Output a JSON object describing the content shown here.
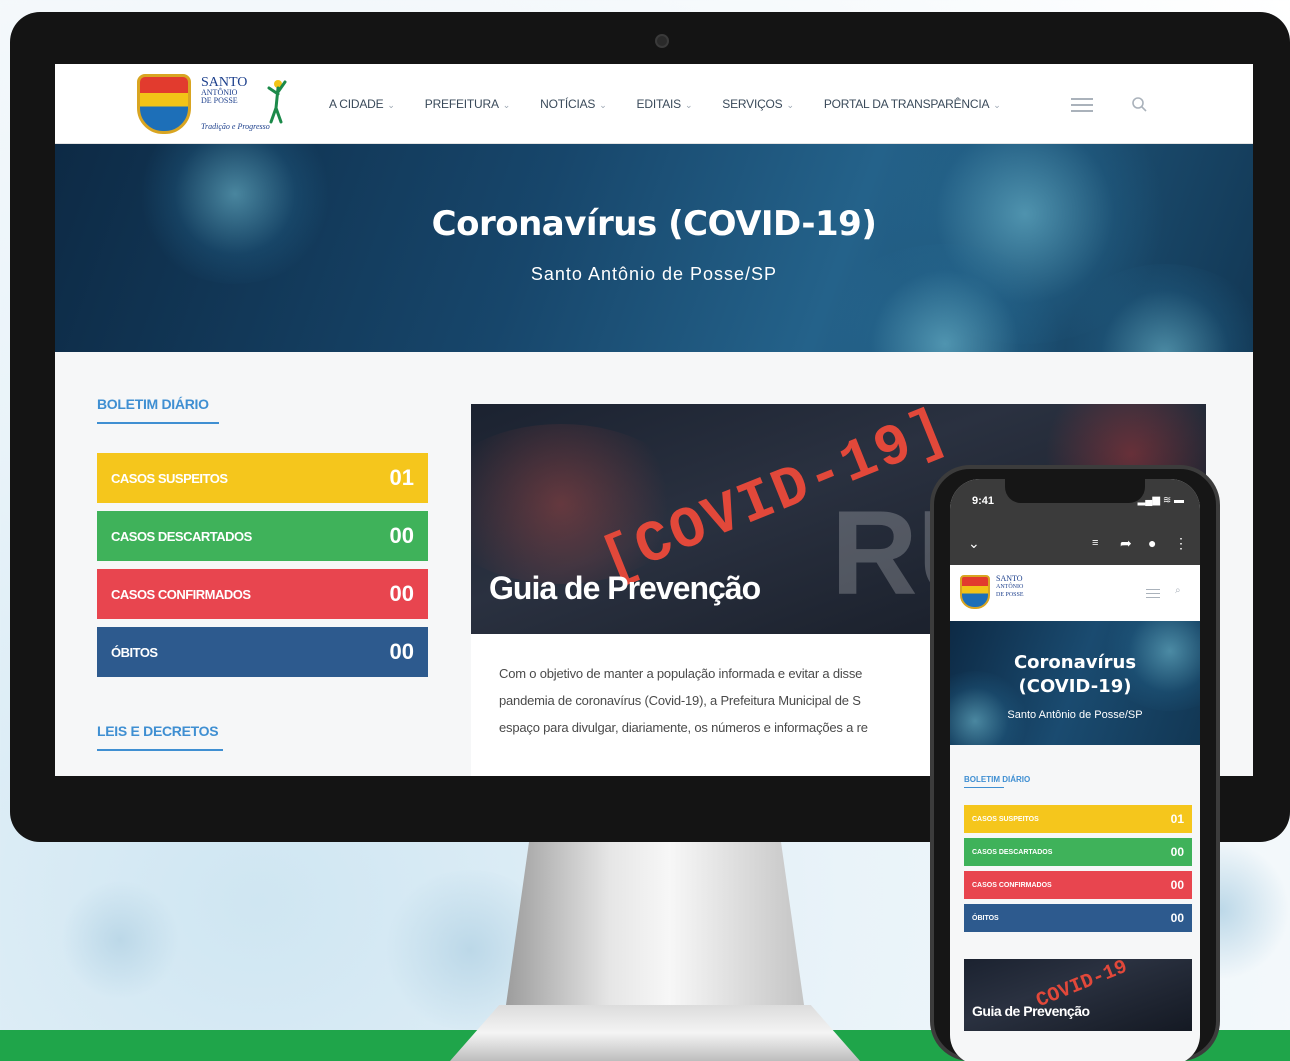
{
  "site": {
    "logo": {
      "line1": "SANTO",
      "line2": "ANTÔNIO",
      "line3": "DE POSSE",
      "slogan": "Tradição e Progresso"
    },
    "nav": [
      {
        "label": "A CIDADE"
      },
      {
        "label": "PREFEITURA"
      },
      {
        "label": "NOTÍCIAS"
      },
      {
        "label": "EDITAIS"
      },
      {
        "label": "SERVIÇOS"
      },
      {
        "label": "PORTAL DA TRANSPARÊNCIA"
      }
    ],
    "hero": {
      "title": "Coronavírus (COVID-19)",
      "subtitle": "Santo Antônio de Posse/SP"
    },
    "sidebar": {
      "bulletin_title": "BOLETIM DIÁRIO",
      "stats": [
        {
          "label": "CASOS SUSPEITOS",
          "value": "01",
          "color": "#f5c61c"
        },
        {
          "label": "CASOS DESCARTADOS",
          "value": "00",
          "color": "#3fb25a"
        },
        {
          "label": "CASOS CONFIRMADOS",
          "value": "00",
          "color": "#e8454f"
        },
        {
          "label": "ÓBITOS",
          "value": "00",
          "color": "#2d5a8e"
        }
      ],
      "laws_title": "LEIS E DECRETOS"
    },
    "article": {
      "image_text": "[COVID-19]",
      "image_text2": "RUS",
      "title": "Guia de Prevenção",
      "lines": [
        "Com o objetivo de manter a população informada e evitar a disse",
        "pandemia de coronavírus (Covid-19), a Prefeitura Municipal de S",
        "espaço para divulgar, diariamente, os números e informações a re"
      ]
    }
  },
  "phone": {
    "time": "9:41",
    "status": "▂▄▆ ≋ ▬",
    "hero_title_line1": "Coronavírus",
    "hero_title_line2": "(COVID-19)",
    "hero_subtitle": "Santo Antônio de Posse/SP",
    "bulletin_title": "BOLETIM DIÁRIO",
    "stats": [
      {
        "label": "CASOS SUSPEITOS",
        "value": "01",
        "color": "#f5c61c"
      },
      {
        "label": "CASOS DESCARTADOS",
        "value": "00",
        "color": "#3fb25a"
      },
      {
        "label": "CASOS CONFIRMADOS",
        "value": "00",
        "color": "#e8454f"
      },
      {
        "label": "ÓBITOS",
        "value": "00",
        "color": "#2d5a8e"
      }
    ],
    "article_image_text": "COVID-19",
    "article_title": "Guia de Prevenção"
  },
  "icons": {
    "nav_chevron": "⌄",
    "search": "search-icon",
    "menu": "hamburger-icon",
    "back": "chevron-down-icon",
    "share": "share-icon",
    "more": "more-icon"
  }
}
